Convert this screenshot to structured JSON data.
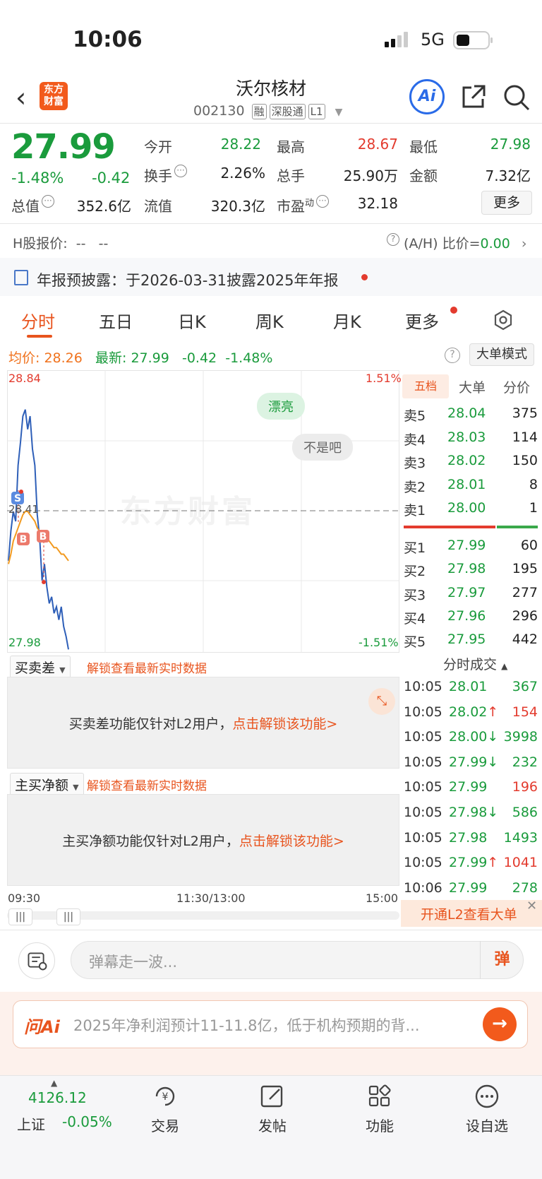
{
  "status": {
    "time": "10:06",
    "network": "5G"
  },
  "header": {
    "stock_name": "沃尔核材",
    "stock_code": "002130",
    "tags": [
      "融",
      "深股通",
      "L1"
    ],
    "logo_text": "东方财富"
  },
  "quote": {
    "price": "27.99",
    "change_pct": "-1.48%",
    "change": "-0.42",
    "fields": [
      {
        "label": "今开",
        "value": "28.22",
        "color": "green"
      },
      {
        "label": "最高",
        "value": "28.67",
        "color": "red"
      },
      {
        "label": "最低",
        "value": "27.98",
        "color": "green"
      },
      {
        "label": "换手",
        "value": "2.26%",
        "color": "black"
      },
      {
        "label": "总手",
        "value": "25.90万",
        "color": "black"
      },
      {
        "label": "金额",
        "value": "7.32亿",
        "color": "black"
      },
      {
        "label": "总值",
        "value": "352.6亿",
        "color": "black"
      },
      {
        "label": "流值",
        "value": "320.3亿",
        "color": "black"
      },
      {
        "label": "市盈",
        "value": "32.18",
        "color": "black"
      }
    ],
    "pe_sup": "动",
    "more_label": "更多"
  },
  "hshare": {
    "label": "H股报价:",
    "v1": "--",
    "v2": "--",
    "ratio_label": "(A/H) 比价=",
    "ratio_value": "0.00"
  },
  "notice": {
    "text": "年报预披露：于2026-03-31披露2025年年报"
  },
  "tabs": [
    "分时",
    "五日",
    "日K",
    "周K",
    "月K",
    "更多"
  ],
  "chart_header": {
    "avg_label": "均价:",
    "avg_value": "28.26",
    "latest_label": "最新:",
    "latest_value": "27.99",
    "change": "-0.42",
    "change_pct": "-1.48%",
    "mode_button": "大单模式"
  },
  "chart_data": {
    "type": "line",
    "y_top": "28.84",
    "y_mid": "28.41",
    "y_bottom": "27.98",
    "pct_top": "1.51%",
    "pct_bottom": "-1.51%",
    "ylim": [
      27.98,
      28.84
    ],
    "series": [
      {
        "color": "#2e5fb8",
        "values": [
          28.26,
          28.35,
          28.41,
          28.38,
          28.55,
          28.62,
          28.7,
          28.72,
          28.66,
          28.7,
          28.6,
          28.55,
          28.4,
          28.33,
          28.2,
          28.25,
          28.18,
          28.13,
          28.15,
          28.1,
          28.12,
          28.08,
          28.12,
          28.06,
          28.03,
          27.99
        ]
      },
      {
        "color": "#f29a1f",
        "values": [
          28.25,
          28.28,
          28.32,
          28.34,
          28.36,
          28.38,
          28.4,
          28.41,
          28.41,
          28.4,
          28.39,
          28.38,
          28.36,
          28.35,
          28.35,
          28.34,
          28.33,
          28.32,
          28.31,
          28.3,
          28.3,
          28.29,
          28.28,
          28.28,
          28.27,
          28.26
        ]
      }
    ],
    "markers": [
      "S",
      "B",
      "B"
    ],
    "x_labels": [
      "09:30",
      "11:30/13:00",
      "15:00"
    ],
    "bubbles": [
      "漂亮",
      "不是吧"
    ],
    "watermark": "东方财富"
  },
  "orderbook": {
    "tabs": [
      "五档",
      "大单",
      "分价"
    ],
    "sells": [
      {
        "label": "卖5",
        "price": "28.04",
        "vol": "375"
      },
      {
        "label": "卖4",
        "price": "28.03",
        "vol": "114"
      },
      {
        "label": "卖3",
        "price": "28.02",
        "vol": "150"
      },
      {
        "label": "卖2",
        "price": "28.01",
        "vol": "8"
      },
      {
        "label": "卖1",
        "price": "28.00",
        "vol": "1"
      }
    ],
    "buys": [
      {
        "label": "买1",
        "price": "27.99",
        "vol": "60"
      },
      {
        "label": "买2",
        "price": "27.98",
        "vol": "195"
      },
      {
        "label": "买3",
        "price": "27.97",
        "vol": "277"
      },
      {
        "label": "买4",
        "price": "27.96",
        "vol": "296"
      },
      {
        "label": "买5",
        "price": "27.95",
        "vol": "442"
      }
    ]
  },
  "ticks": {
    "title": "分时成交",
    "rows": [
      {
        "t": "10:05",
        "p": "28.01",
        "arrow": "",
        "v": "367",
        "pc": "green",
        "vc": "green"
      },
      {
        "t": "10:05",
        "p": "28.02",
        "arrow": "↑",
        "v": "154",
        "pc": "green",
        "vc": "red"
      },
      {
        "t": "10:05",
        "p": "28.00",
        "arrow": "↓",
        "v": "3998",
        "pc": "green",
        "vc": "green"
      },
      {
        "t": "10:05",
        "p": "27.99",
        "arrow": "↓",
        "v": "232",
        "pc": "green",
        "vc": "green"
      },
      {
        "t": "10:05",
        "p": "27.99",
        "arrow": "",
        "v": "196",
        "pc": "green",
        "vc": "red"
      },
      {
        "t": "10:05",
        "p": "27.98",
        "arrow": "↓",
        "v": "586",
        "pc": "green",
        "vc": "green"
      },
      {
        "t": "10:05",
        "p": "27.98",
        "arrow": "",
        "v": "1493",
        "pc": "green",
        "vc": "green"
      },
      {
        "t": "10:05",
        "p": "27.99",
        "arrow": "↑",
        "v": "1041",
        "pc": "green",
        "vc": "red"
      },
      {
        "t": "10:06",
        "p": "27.99",
        "arrow": "",
        "v": "278",
        "pc": "green",
        "vc": "green"
      }
    ],
    "l2_label": "开通L2查看大单"
  },
  "panels": {
    "p1_select": "买卖差",
    "p1_unlock": "解锁查看最新实时数据",
    "p1_text": "买卖差功能仅针对L2用户，",
    "p1_link": "点击解锁该功能>",
    "p2_select": "主买净额",
    "p2_unlock": "解锁查看最新实时数据",
    "p2_text": "主买净额功能仅针对L2用户，",
    "p2_link": "点击解锁该功能>"
  },
  "danmaku": {
    "placeholder": "弹幕走一波...",
    "button": "弹"
  },
  "ask": {
    "logo": "问Ai",
    "text": "2025年净利润预计11-11.8亿，低于机构预期的背..."
  },
  "bottom": {
    "index_value": "4126.12",
    "index_name": "上证",
    "index_pct": "-0.05%",
    "nav": [
      "交易",
      "发帖",
      "功能",
      "设自选"
    ]
  }
}
